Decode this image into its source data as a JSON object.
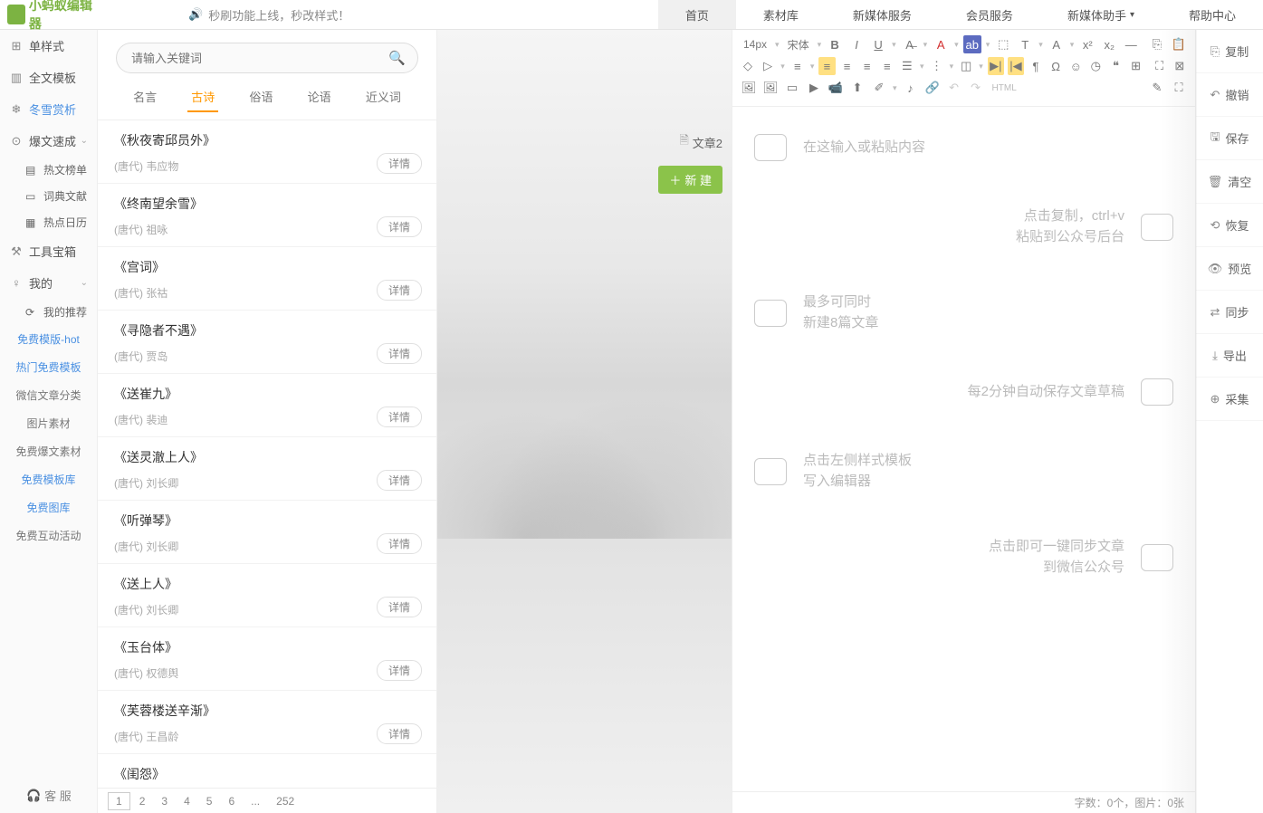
{
  "header": {
    "logo_text": "小蚂蚁编辑器",
    "notice": "秒刷功能上线，秒改样式！",
    "nav": [
      "首页",
      "素材库",
      "新媒体服务",
      "会员服务",
      "新媒体助手",
      "帮助中心"
    ],
    "nav_active": 0,
    "nav_dropdown": [
      4
    ]
  },
  "sidebar": {
    "items": [
      {
        "icon": "⊞",
        "label": "单样式"
      },
      {
        "icon": "▥",
        "label": "全文模板"
      },
      {
        "icon": "❄",
        "label": "冬雪赏析",
        "blue": true
      },
      {
        "icon": "⊙",
        "label": "爆文速成",
        "caret": true
      }
    ],
    "subs": [
      {
        "icon": "▤",
        "label": "热文榜单"
      },
      {
        "icon": "▭",
        "label": "词典文献"
      },
      {
        "icon": "▦",
        "label": "热点日历"
      }
    ],
    "items2": [
      {
        "icon": "⚒",
        "label": "工具宝箱"
      },
      {
        "icon": "♀",
        "label": "我的",
        "caret": true
      }
    ],
    "sub_rec": {
      "icon": "⟳",
      "label": "我的推荐"
    },
    "links": [
      {
        "label": "免费模版-hot",
        "cls": "blue"
      },
      {
        "label": "热门免费模板",
        "cls": "blue"
      },
      {
        "label": "微信文章分类",
        "cls": "gray"
      },
      {
        "label": "图片素材",
        "cls": "gray"
      },
      {
        "label": "免费爆文素材",
        "cls": "gray"
      },
      {
        "label": "免费模板库",
        "cls": "blue"
      },
      {
        "label": "免费图库",
        "cls": "blue"
      },
      {
        "label": "免费互动活动",
        "cls": "gray"
      }
    ],
    "service": "客 服"
  },
  "panel": {
    "search_placeholder": "请输入关键词",
    "tabs": [
      "名言",
      "古诗",
      "俗语",
      "论语",
      "近义词"
    ],
    "tab_active": 1,
    "detail_label": "详情",
    "poems": [
      {
        "title": "《秋夜寄邱员外》",
        "author": "(唐代) 韦应物"
      },
      {
        "title": "《终南望余雪》",
        "author": "(唐代) 祖咏"
      },
      {
        "title": "《宫词》",
        "author": "(唐代) 张祜"
      },
      {
        "title": "《寻隐者不遇》",
        "author": "(唐代) 贾岛"
      },
      {
        "title": "《送崔九》",
        "author": "(唐代) 裴迪"
      },
      {
        "title": "《送灵澈上人》",
        "author": "(唐代) 刘长卿"
      },
      {
        "title": "《听弹琴》",
        "author": "(唐代) 刘长卿"
      },
      {
        "title": "《送上人》",
        "author": "(唐代) 刘长卿"
      },
      {
        "title": "《玉台体》",
        "author": "(唐代) 权德舆"
      },
      {
        "title": "《芙蓉楼送辛渐》",
        "author": "(唐代) 王昌龄"
      },
      {
        "title": "《闺怨》",
        "author": ""
      }
    ],
    "pages": [
      "1",
      "2",
      "3",
      "4",
      "5",
      "6",
      "...",
      "252"
    ],
    "page_active": 0
  },
  "middle": {
    "article_label": "文章2",
    "new_label": "新 建"
  },
  "editor": {
    "font_size": "14px",
    "font_family": "宋体",
    "html_label": "HTML",
    "hints": [
      {
        "side": "left",
        "lines": [
          "在这输入或粘贴内容"
        ]
      },
      {
        "side": "right",
        "lines": [
          "点击复制，ctrl+v",
          "粘贴到公众号后台"
        ]
      },
      {
        "side": "left",
        "lines": [
          "最多可同时",
          "新建8篇文章"
        ]
      },
      {
        "side": "right",
        "lines": [
          "每2分钟自动保存文章草稿"
        ]
      },
      {
        "side": "left",
        "lines": [
          "点击左侧样式模板",
          "写入编辑器"
        ]
      },
      {
        "side": "right",
        "lines": [
          "点击即可一键同步文章",
          "到微信公众号"
        ]
      }
    ],
    "footer": "字数：0个，图片：0张"
  },
  "right_actions": [
    {
      "icon": "⎘",
      "label": "复制"
    },
    {
      "icon": "↶",
      "label": "撤销"
    },
    {
      "icon": "🖫",
      "label": "保存"
    },
    {
      "icon": "🗑",
      "label": "清空"
    },
    {
      "icon": "⟲",
      "label": "恢复"
    },
    {
      "icon": "👁",
      "label": "预览"
    },
    {
      "icon": "⇄",
      "label": "同步"
    },
    {
      "icon": "⤓",
      "label": "导出"
    },
    {
      "icon": "⊕",
      "label": "采集"
    }
  ]
}
